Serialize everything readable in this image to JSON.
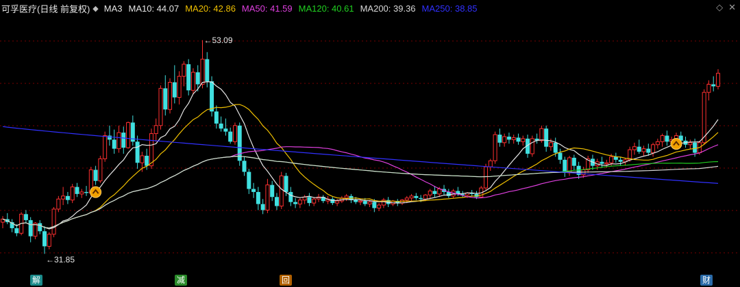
{
  "header": {
    "title": "可孚医疗(日线 前复权)",
    "ma_items": [
      {
        "label": "MA3",
        "color": "#e6e6e6"
      },
      {
        "label": "MA10: 44.07",
        "color": "#e6e6e6"
      },
      {
        "label": "MA20: 42.86",
        "color": "#f0c000"
      },
      {
        "label": "MA50: 41.59",
        "color": "#e040e0"
      },
      {
        "label": "MA120: 40.61",
        "color": "#20d020"
      },
      {
        "label": "MA200: 39.36",
        "color": "#d8d8d8"
      },
      {
        "label": "MA250: 38.85",
        "color": "#3030ff"
      }
    ]
  },
  "annotations": {
    "high": "53.09",
    "low": "31.85"
  },
  "markers": [
    {
      "label": "解",
      "color": "#1a8a8a"
    },
    {
      "label": "减",
      "color": "#2a8a2a"
    },
    {
      "label": "回",
      "color": "#b06000"
    },
    {
      "label": "财",
      "color": "#2a6aa8"
    }
  ],
  "colors": {
    "up": "#ff3030",
    "down": "#40e0e0",
    "grid": "#7a0000",
    "ma10": "#e6e6e6",
    "ma20": "#f0c000",
    "ma50": "#e040e0",
    "ma120": "#20d020",
    "ma200": "#d8d8d8",
    "ma250": "#3030ff",
    "signal": "#f0a000"
  },
  "chart_data": {
    "type": "candlestick",
    "ylim": [
      31.0,
      54.5
    ],
    "candles": [
      [
        35.0,
        35.6,
        34.4,
        35.3
      ],
      [
        35.3,
        35.9,
        34.8,
        35.0
      ],
      [
        35.0,
        35.3,
        34.0,
        34.4
      ],
      [
        34.4,
        34.8,
        33.6,
        33.9
      ],
      [
        33.9,
        36.0,
        33.7,
        35.8
      ],
      [
        35.8,
        36.2,
        34.9,
        35.2
      ],
      [
        35.2,
        35.5,
        33.0,
        33.6
      ],
      [
        33.6,
        35.0,
        33.3,
        34.9
      ],
      [
        34.9,
        35.2,
        33.8,
        34.1
      ],
      [
        34.1,
        34.6,
        31.85,
        32.6
      ],
      [
        32.6,
        34.0,
        32.3,
        33.8
      ],
      [
        33.8,
        36.5,
        33.5,
        36.3
      ],
      [
        36.3,
        37.6,
        36.0,
        37.3
      ],
      [
        37.3,
        38.5,
        36.7,
        37.6
      ],
      [
        37.6,
        38.0,
        36.8,
        37.2
      ],
      [
        37.2,
        38.8,
        36.9,
        38.5
      ],
      [
        38.5,
        38.9,
        37.5,
        37.8
      ],
      [
        37.8,
        38.3,
        37.4,
        38.0
      ],
      [
        38.0,
        38.6,
        37.6,
        37.9
      ],
      [
        37.9,
        40.5,
        37.6,
        40.2
      ],
      [
        40.2,
        40.6,
        38.7,
        39.1
      ],
      [
        39.1,
        41.6,
        38.9,
        41.3
      ],
      [
        41.3,
        44.0,
        41.0,
        43.6
      ],
      [
        43.6,
        44.6,
        42.6,
        43.2
      ],
      [
        43.2,
        44.2,
        41.8,
        42.3
      ],
      [
        42.3,
        44.6,
        41.9,
        43.9
      ],
      [
        43.9,
        44.5,
        41.8,
        42.4
      ],
      [
        42.4,
        45.0,
        42.3,
        44.9
      ],
      [
        44.9,
        45.6,
        42.6,
        43.0
      ],
      [
        43.0,
        43.6,
        40.3,
        40.9
      ],
      [
        40.9,
        42.0,
        40.0,
        41.6
      ],
      [
        41.6,
        42.3,
        40.2,
        40.6
      ],
      [
        40.6,
        44.3,
        40.3,
        43.8
      ],
      [
        43.8,
        45.3,
        43.0,
        44.6
      ],
      [
        44.6,
        48.6,
        44.2,
        48.3
      ],
      [
        48.3,
        49.6,
        45.6,
        46.2
      ],
      [
        46.2,
        49.3,
        45.8,
        48.9
      ],
      [
        48.9,
        50.6,
        46.8,
        47.4
      ],
      [
        47.4,
        50.0,
        46.7,
        49.5
      ],
      [
        49.5,
        51.0,
        48.5,
        50.7
      ],
      [
        50.7,
        51.2,
        47.6,
        48.1
      ],
      [
        48.1,
        50.3,
        47.7,
        49.9
      ],
      [
        49.9,
        50.6,
        48.0,
        48.7
      ],
      [
        48.7,
        53.09,
        48.3,
        51.2
      ],
      [
        51.2,
        51.9,
        48.4,
        49.0
      ],
      [
        49.0,
        49.5,
        45.5,
        46.0
      ],
      [
        46.0,
        46.6,
        44.3,
        44.8
      ],
      [
        44.8,
        45.5,
        44.0,
        44.3
      ],
      [
        44.3,
        45.3,
        43.6,
        44.0
      ],
      [
        44.0,
        44.4,
        42.8,
        43.0
      ],
      [
        43.0,
        44.9,
        42.7,
        44.6
      ],
      [
        44.6,
        44.9,
        40.6,
        41.1
      ],
      [
        41.1,
        41.5,
        39.6,
        40.0
      ],
      [
        40.0,
        40.3,
        37.8,
        38.3
      ],
      [
        38.3,
        38.9,
        37.4,
        38.0
      ],
      [
        38.0,
        38.5,
        36.2,
        36.8
      ],
      [
        36.8,
        37.3,
        35.8,
        36.2
      ],
      [
        36.2,
        39.3,
        35.9,
        38.7
      ],
      [
        38.7,
        39.1,
        37.1,
        37.5
      ],
      [
        37.5,
        37.9,
        36.2,
        36.6
      ],
      [
        36.6,
        40.0,
        36.3,
        39.6
      ],
      [
        39.6,
        39.9,
        37.6,
        38.0
      ],
      [
        38.0,
        38.5,
        36.6,
        37.0
      ],
      [
        37.0,
        37.4,
        36.4,
        36.8
      ],
      [
        36.8,
        37.4,
        36.4,
        37.2
      ],
      [
        37.2,
        37.7,
        36.8,
        37.5
      ],
      [
        37.5,
        37.9,
        36.6,
        36.9
      ],
      [
        36.9,
        37.5,
        36.6,
        37.3
      ],
      [
        37.3,
        37.8,
        37.0,
        37.5
      ],
      [
        37.5,
        37.7,
        36.9,
        37.1
      ],
      [
        37.1,
        37.6,
        36.8,
        37.3
      ],
      [
        37.3,
        37.5,
        36.7,
        36.9
      ],
      [
        36.9,
        37.3,
        36.6,
        37.1
      ],
      [
        37.1,
        37.6,
        36.9,
        37.4
      ],
      [
        37.4,
        37.8,
        37.1,
        37.6
      ],
      [
        37.6,
        37.8,
        36.9,
        37.2
      ],
      [
        37.2,
        37.5,
        36.8,
        37.0
      ],
      [
        37.0,
        37.3,
        36.7,
        37.1
      ],
      [
        37.1,
        37.4,
        36.6,
        36.8
      ],
      [
        36.8,
        37.2,
        36.5,
        37.0
      ],
      [
        37.0,
        37.3,
        36.0,
        36.4
      ],
      [
        36.4,
        36.9,
        36.1,
        36.7
      ],
      [
        36.7,
        37.4,
        36.4,
        37.2
      ],
      [
        37.2,
        37.5,
        36.5,
        36.8
      ],
      [
        36.8,
        37.2,
        36.6,
        37.1
      ],
      [
        37.1,
        37.3,
        36.6,
        36.9
      ],
      [
        36.9,
        37.3,
        36.7,
        37.2
      ],
      [
        37.2,
        37.6,
        36.9,
        37.4
      ],
      [
        37.4,
        37.8,
        37.1,
        37.6
      ],
      [
        37.6,
        37.9,
        37.2,
        37.4
      ],
      [
        37.4,
        37.7,
        37.0,
        37.3
      ],
      [
        37.3,
        37.8,
        37.1,
        37.7
      ],
      [
        37.7,
        38.3,
        37.3,
        38.1
      ],
      [
        38.1,
        38.6,
        37.5,
        37.8
      ],
      [
        37.8,
        38.5,
        37.5,
        38.3
      ],
      [
        38.3,
        38.7,
        37.7,
        38.0
      ],
      [
        38.0,
        38.3,
        37.4,
        37.6
      ],
      [
        37.6,
        38.3,
        37.4,
        38.1
      ],
      [
        38.1,
        38.5,
        37.6,
        37.8
      ],
      [
        37.8,
        38.1,
        37.5,
        37.7
      ],
      [
        37.7,
        38.0,
        37.4,
        37.9
      ],
      [
        37.9,
        38.2,
        37.6,
        37.8
      ],
      [
        37.8,
        38.1,
        37.3,
        37.5
      ],
      [
        37.5,
        38.6,
        37.4,
        38.4
      ],
      [
        38.4,
        40.8,
        38.2,
        40.5
      ],
      [
        40.5,
        41.3,
        40.1,
        41.1
      ],
      [
        41.1,
        44.0,
        40.8,
        43.7
      ],
      [
        43.7,
        44.3,
        42.5,
        42.9
      ],
      [
        42.9,
        43.8,
        42.5,
        43.5
      ],
      [
        43.5,
        43.9,
        42.8,
        43.2
      ],
      [
        43.2,
        43.7,
        42.8,
        43.4
      ],
      [
        43.4,
        43.8,
        42.7,
        43.0
      ],
      [
        43.0,
        43.6,
        42.6,
        43.3
      ],
      [
        43.3,
        43.7,
        41.4,
        41.8
      ],
      [
        41.8,
        43.6,
        41.5,
        43.3
      ],
      [
        43.3,
        43.8,
        42.8,
        43.1
      ],
      [
        43.1,
        44.6,
        42.9,
        44.3
      ],
      [
        44.3,
        44.6,
        42.0,
        42.5
      ],
      [
        42.5,
        43.3,
        42.1,
        42.9
      ],
      [
        42.9,
        43.4,
        41.5,
        41.9
      ],
      [
        41.9,
        42.3,
        40.8,
        41.2
      ],
      [
        41.2,
        41.5,
        39.5,
        39.9
      ],
      [
        39.9,
        41.6,
        39.6,
        41.4
      ],
      [
        41.4,
        41.7,
        40.2,
        40.6
      ],
      [
        40.6,
        41.0,
        39.3,
        39.7
      ],
      [
        39.7,
        40.5,
        39.4,
        40.2
      ],
      [
        40.2,
        41.6,
        39.9,
        41.3
      ],
      [
        41.3,
        41.7,
        40.2,
        40.6
      ],
      [
        40.6,
        41.3,
        40.2,
        41.0
      ],
      [
        41.0,
        41.5,
        40.4,
        40.8
      ],
      [
        40.8,
        41.2,
        40.4,
        40.9
      ],
      [
        40.9,
        41.8,
        40.6,
        41.5
      ],
      [
        41.5,
        41.9,
        40.9,
        41.2
      ],
      [
        41.2,
        41.5,
        40.6,
        41.0
      ],
      [
        41.0,
        41.4,
        40.6,
        41.2
      ],
      [
        41.2,
        42.5,
        41.0,
        42.2
      ],
      [
        42.2,
        42.9,
        41.7,
        42.5
      ],
      [
        42.5,
        43.2,
        41.8,
        42.0
      ],
      [
        42.0,
        42.6,
        41.6,
        42.3
      ],
      [
        42.3,
        42.8,
        41.6,
        41.9
      ],
      [
        41.9,
        42.9,
        41.5,
        42.7
      ],
      [
        42.7,
        43.3,
        42.3,
        43.0
      ],
      [
        43.0,
        43.8,
        42.5,
        43.6
      ],
      [
        43.6,
        44.1,
        42.6,
        43.0
      ],
      [
        43.0,
        43.5,
        42.6,
        43.2
      ],
      [
        43.2,
        43.9,
        42.8,
        43.6
      ],
      [
        43.6,
        44.0,
        42.7,
        43.1
      ],
      [
        43.1,
        43.5,
        42.4,
        42.7
      ],
      [
        42.7,
        43.2,
        42.3,
        42.9
      ],
      [
        42.9,
        43.3,
        41.5,
        41.9
      ],
      [
        41.9,
        43.1,
        41.7,
        42.9
      ],
      [
        42.9,
        48.2,
        42.7,
        47.9
      ],
      [
        47.9,
        49.1,
        47.1,
        48.7
      ],
      [
        48.7,
        49.5,
        48.0,
        48.5
      ],
      [
        48.5,
        50.2,
        48.2,
        49.8
      ]
    ],
    "signals": [
      20,
      145
    ]
  }
}
